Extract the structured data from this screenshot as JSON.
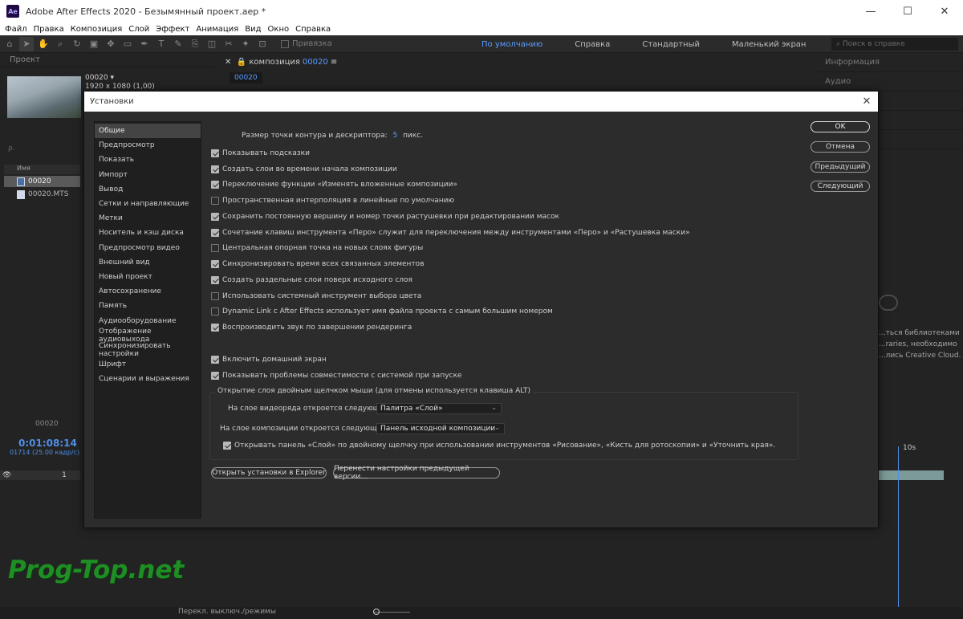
{
  "app": {
    "logo_text": "Ae",
    "title": "Adobe After Effects 2020 - Безымянный проект.aep *",
    "window_controls": [
      "—",
      "☐",
      "✕"
    ]
  },
  "menu": [
    "Файл",
    "Правка",
    "Композиция",
    "Слой",
    "Эффект",
    "Анимация",
    "Вид",
    "Окно",
    "Справка"
  ],
  "toolbar": {
    "snap_label": "Привязка",
    "workspaces": [
      "По умолчанию",
      "Справка",
      "Стандартный",
      "Маленький экран"
    ],
    "active_workspace": "По умолчанию",
    "help_search_placeholder": "Поиск в справке"
  },
  "project_panel": {
    "header": "Проект",
    "comp_name": "00020 ▾",
    "comp_info": "1920 x 1080 (1,00)",
    "search_placeholder": "ρ.",
    "column_name": "Имя",
    "items": [
      "00020",
      "00020.MTS"
    ]
  },
  "composition_panel": {
    "tab_prefix": "композиция",
    "tab_name": "00020",
    "breadcrumb": "00020"
  },
  "right_panel": {
    "rows": [
      "Информация",
      "Аудио",
      "",
      "",
      "",
      "",
      ""
    ],
    "library_text": [
      "...ться библиотеками",
      "...raries, необходимо",
      "...лись Creative Cloud."
    ]
  },
  "timeline": {
    "comp_tab": "00020",
    "timecode": "0:01:08:14",
    "fps": "01714 (25.00 кадр/с)",
    "layer_number": "1",
    "ruler_label": "10s",
    "status_text": "Перекл. выключ./режимы"
  },
  "watermark": "Prog-Top.net",
  "dialog": {
    "title": "Установки",
    "close_icon": "✕",
    "categories": [
      "Общие",
      "Предпросмотр",
      "Показать",
      "Импорт",
      "Вывод",
      "Сетки и направляющие",
      "Метки",
      "Носитель и кэш диска",
      "Предпросмотр видео",
      "Внешний вид",
      "Новый проект",
      "Автосохранение",
      "Память",
      "Аудиооборудование",
      "Отображение аудиовыхода",
      "Синхронизировать настройки",
      "Шрифт",
      "Сценарии и выражения"
    ],
    "selected_category": "Общие",
    "point_size": {
      "label": "Размер точки контура и дескриптора:",
      "value": "5",
      "unit": "пикс."
    },
    "checkboxes": [
      {
        "label": "Показывать подсказки",
        "checked": true
      },
      {
        "label": "Создать слои во времени начала композиции",
        "checked": true
      },
      {
        "label": "Переключение функции «Изменять вложенные композиции»",
        "checked": true
      },
      {
        "label": "Пространственная интерполяция в линейные по умолчанию",
        "checked": false
      },
      {
        "label": "Сохранить постоянную вершину и номер точки растушевки при редактировании масок",
        "checked": true
      },
      {
        "label": "Сочетание клавиш инструмента «Перо» служит для переключения между инструментами «Перо» и «Растушевка маски»",
        "checked": true
      },
      {
        "label": "Центральная опорная точка на новых слоях фигуры",
        "checked": false
      },
      {
        "label": "Синхронизировать время всех связанных элементов",
        "checked": true
      },
      {
        "label": "Создать раздельные слои поверх исходного слоя",
        "checked": true
      },
      {
        "label": "Использовать системный инструмент выбора цвета",
        "checked": false
      },
      {
        "label": "Dynamic Link с After Effects использует имя файла проекта с самым большим номером",
        "checked": false
      },
      {
        "label": "Воспроизводить звук по завершении рендеринга",
        "checked": true
      },
      {
        "label": "Включить домашний экран",
        "checked": true
      },
      {
        "label": "Показывать проблемы совместимости с системой при запуске",
        "checked": true
      }
    ],
    "group": {
      "legend": "Открытие слоя двойным щелчком мыши (для отмены используется клавиша ALT)",
      "footage_label": "На слое видеоряда откроется следующее:",
      "footage_value": "Палитра «Слой»",
      "comp_label": "На слое композиции откроется следующее:",
      "comp_value": "Панель исходной композиции",
      "open_panel": {
        "label": "Открывать панель «Слой» по двойному щелчку при использовании инструментов «Рисование», «Кисть для ротоскопии» и «Уточнить края».",
        "checked": true
      }
    },
    "buttons": {
      "ok": "OK",
      "cancel": "Отмена",
      "previous": "Предыдущий",
      "next": "Следующий",
      "reveal": "Открыть установки в Explorer",
      "migrate": "Перенести настройки предыдущей версии..."
    }
  }
}
